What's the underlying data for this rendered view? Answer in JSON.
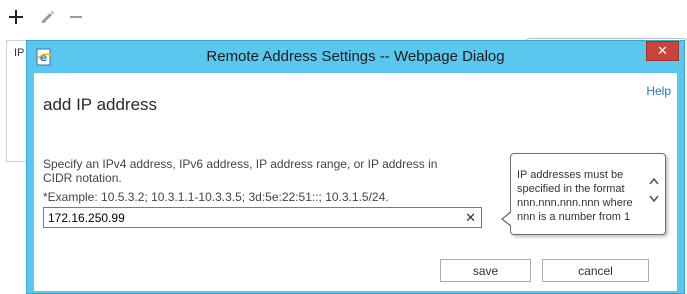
{
  "background": {
    "toolbar": {
      "add_icon": "plus-icon",
      "edit_icon": "pencil-icon",
      "remove_icon": "minus-icon"
    },
    "panel_label": "IP"
  },
  "dialog": {
    "title": "Remote Address Settings -- Webpage Dialog",
    "icon": "ie-page-icon",
    "close_label": "✕",
    "heading": "add IP address",
    "help_label": "Help",
    "instructions": "Specify an IPv4 address, IPv6 address, IP address range, or IP address in CIDR notation.",
    "example": "*Example: 10.5.3.2; 10.3.1.1-10.3.3.5; 3d:5e:22:51::; 10.3.1.5/24.",
    "ip_input": {
      "value": "172.16.250.99",
      "placeholder": ""
    },
    "clear_label": "✕",
    "tooltip": {
      "text": "IP addresses must be specified in the format nnn.nnn.nnn.nnn where nnn is a number from 1",
      "up": "^",
      "down": "v"
    },
    "save_label": "save",
    "cancel_label": "cancel"
  },
  "colors": {
    "dialog_frame": "#5ac8ee",
    "close_button": "#c7453b",
    "help_link": "#1976c2"
  }
}
